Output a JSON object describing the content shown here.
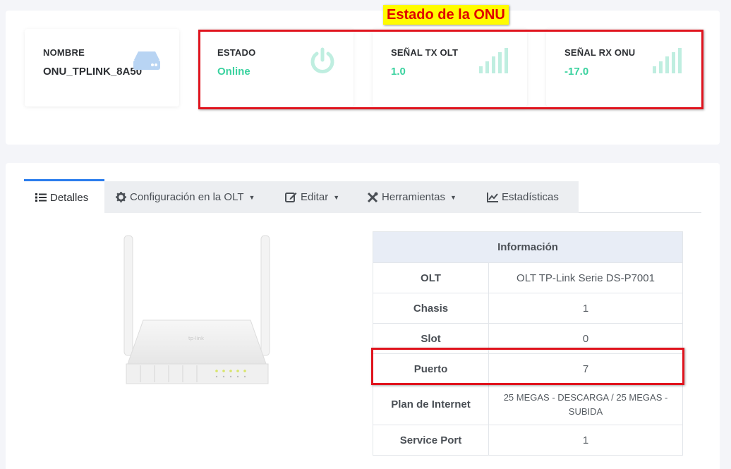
{
  "annotation": {
    "title": "Estado de la ONU"
  },
  "cards": {
    "nombre": {
      "label": "NOMBRE",
      "value": "ONU_TPLINK_8A50",
      "icon": "drive-icon"
    },
    "estado": {
      "label": "ESTADO",
      "value": "Online",
      "icon": "power-icon"
    },
    "tx": {
      "label": "SEÑAL TX OLT",
      "value": "1.0",
      "icon": "signal-icon"
    },
    "rx": {
      "label": "SEÑAL RX ONU",
      "value": "-17.0",
      "icon": "signal-icon"
    }
  },
  "colors": {
    "accent": "#3ad29f",
    "tab_active": "#2b7ded",
    "annotation": "#e0141e",
    "highlight": "#fffc00"
  },
  "tabs": [
    {
      "label": "Detalles",
      "icon": "list-icon"
    },
    {
      "label": "Configuración en la OLT",
      "icon": "gear-icon",
      "dropdown": true
    },
    {
      "label": "Editar",
      "icon": "edit-icon",
      "dropdown": true
    },
    {
      "label": "Herramientas",
      "icon": "tools-icon",
      "dropdown": true
    },
    {
      "label": "Estadísticas",
      "icon": "chart-icon"
    }
  ],
  "info_table": {
    "header": "Información",
    "rows": [
      {
        "key": "OLT",
        "value": "OLT TP-Link Serie DS-P7001"
      },
      {
        "key": "Chasis",
        "value": "1"
      },
      {
        "key": "Slot",
        "value": "0"
      },
      {
        "key": "Puerto",
        "value": "7"
      },
      {
        "key": "Plan de Internet",
        "value": "25 MEGAS - DESCARGA / 25 MEGAS - SUBIDA"
      },
      {
        "key": "Service Port",
        "value": "1"
      }
    ]
  },
  "device_image": {
    "brand": "tp-link"
  }
}
